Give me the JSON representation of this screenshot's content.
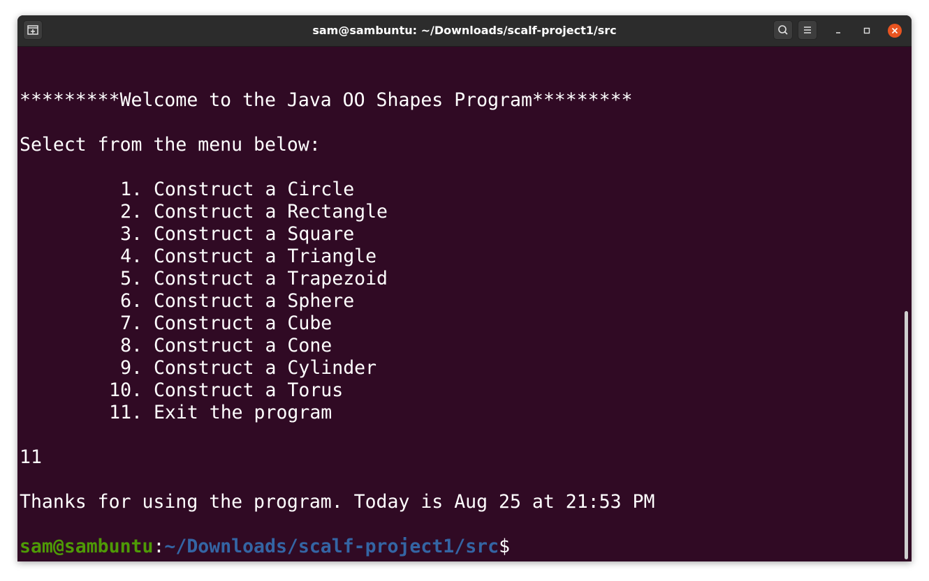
{
  "window": {
    "title": "sam@sambuntu: ~/Downloads/scalf-project1/src",
    "icons": {
      "new_tab": "new-tab-icon",
      "search": "search-icon",
      "menu": "hamburger-menu-icon",
      "minimize": "minimize-icon",
      "maximize": "maximize-icon",
      "close": "close-icon"
    }
  },
  "terminal": {
    "welcome": "*********Welcome to the Java OO Shapes Program*********",
    "menu_prompt": "Select from the menu below:",
    "menu": [
      {
        "num": "1.",
        "label": "Construct a Circle"
      },
      {
        "num": "2.",
        "label": "Construct a Rectangle"
      },
      {
        "num": "3.",
        "label": "Construct a Square"
      },
      {
        "num": "4.",
        "label": "Construct a Triangle"
      },
      {
        "num": "5.",
        "label": "Construct a Trapezoid"
      },
      {
        "num": "6.",
        "label": "Construct a Sphere"
      },
      {
        "num": "7.",
        "label": "Construct a Cube"
      },
      {
        "num": "8.",
        "label": "Construct a Cone"
      },
      {
        "num": "9.",
        "label": "Construct a Cylinder"
      },
      {
        "num": "10.",
        "label": "Construct a Torus"
      },
      {
        "num": "11.",
        "label": "Exit the program"
      }
    ],
    "user_input": "11",
    "goodbye": "Thanks for using the program. Today is Aug 25 at 21:53 PM",
    "prompt": {
      "user_host": "sam@sambuntu",
      "separator": ":",
      "path": "~/Downloads/scalf-project1/src",
      "symbol": "$"
    }
  },
  "colors": {
    "terminal_bg": "#300a24",
    "titlebar_bg": "#2c2c2c",
    "prompt_user": "#4e9a06",
    "prompt_path": "#3465a4",
    "close_button": "#e95420"
  }
}
